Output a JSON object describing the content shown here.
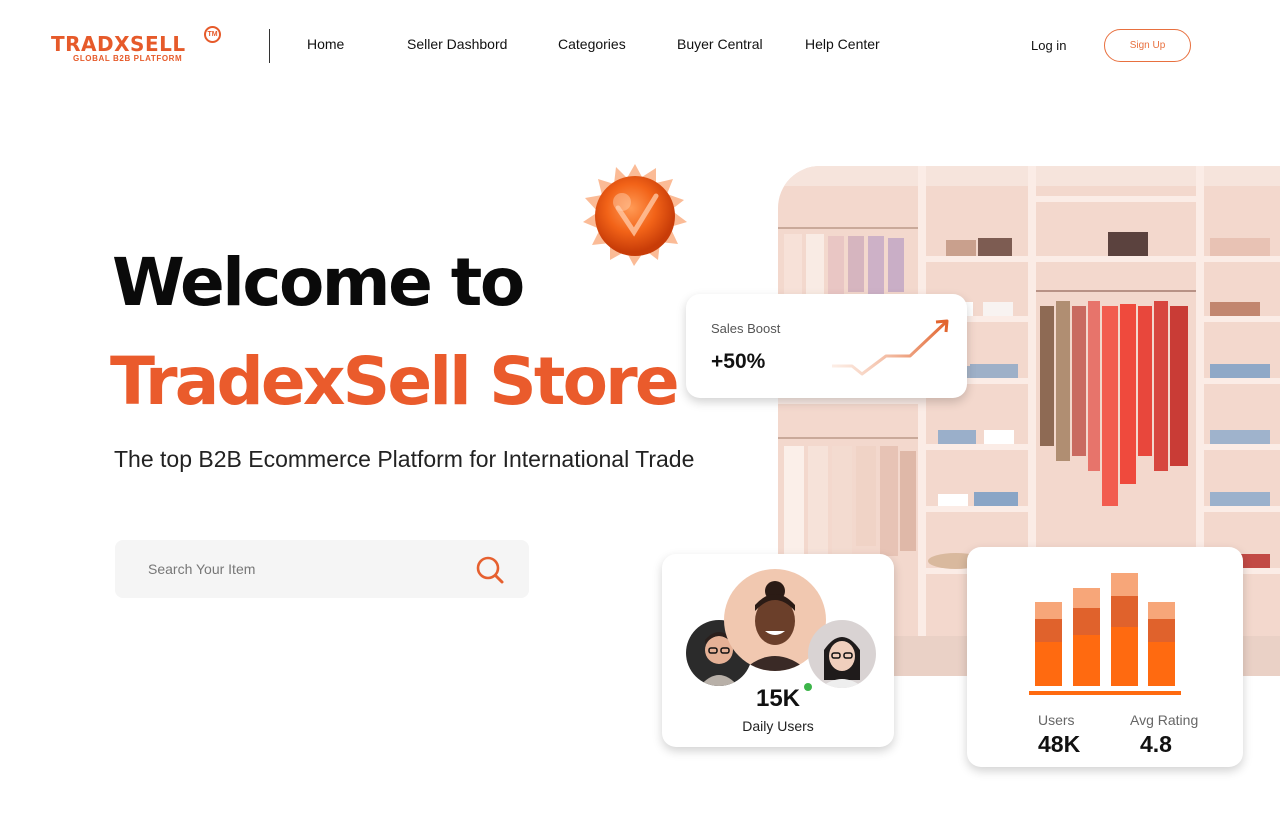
{
  "brand": {
    "name": "TRADXSELL",
    "trademark": "TM",
    "tagline": "GLOBAL B2B PLATFORM",
    "accent_color": "#ea5b2c"
  },
  "nav": {
    "items": [
      {
        "label": "Home"
      },
      {
        "label": "Seller Dashbord"
      },
      {
        "label": "Categories"
      },
      {
        "label": "Buyer Central"
      },
      {
        "label": "Help Center"
      }
    ],
    "login_label": "Log in",
    "signup_label": "Sign Up"
  },
  "hero": {
    "title_line1": "Welcome to",
    "title_line2": "TradexSell Store",
    "subtitle": "The top B2B Ecommerce Platform for International Trade"
  },
  "search": {
    "placeholder": "Search Your Item",
    "value": "",
    "icon": "search-icon"
  },
  "sales_card": {
    "title": "Sales Boost",
    "value": "+50%",
    "icon": "trend-up-icon"
  },
  "users_card": {
    "value": "15K",
    "label": "Daily Users",
    "status_color": "#3cb54a"
  },
  "stats_card": {
    "items": [
      {
        "label": "Users",
        "value": "48K"
      },
      {
        "label": "Avg Rating",
        "value": "4.8"
      }
    ],
    "bar_colors": [
      "#ff6a10",
      "#f7a679",
      "#e0622c"
    ]
  }
}
